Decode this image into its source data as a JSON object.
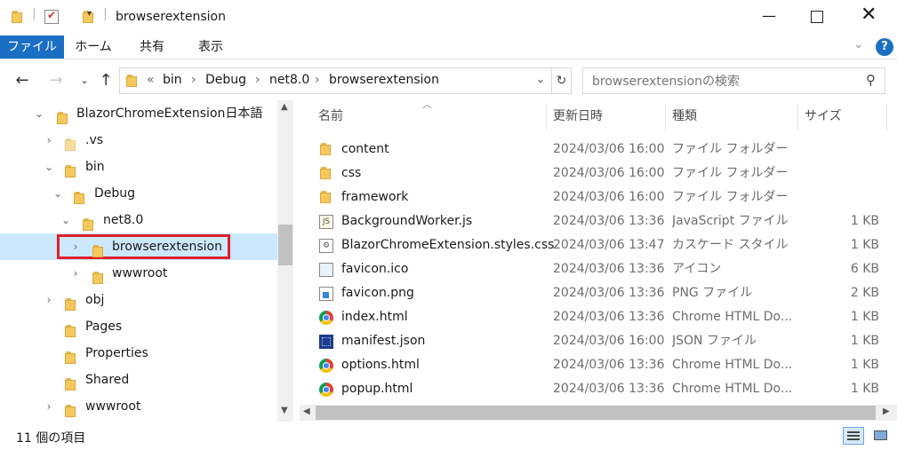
{
  "titlebar": {
    "title": "browserextension"
  },
  "ribbon": {
    "tabs": [
      "ファイル",
      "ホーム",
      "共有",
      "表示"
    ]
  },
  "address": {
    "crumbs": [
      "bin",
      "Debug",
      "net8.0",
      "browserextension"
    ],
    "prefix": "«"
  },
  "search": {
    "placeholder": "browserextensionの検索"
  },
  "tree": {
    "items": [
      {
        "label": "BlazorChromeExtension日本語"
      },
      {
        "label": ".vs"
      },
      {
        "label": "bin"
      },
      {
        "label": "Debug"
      },
      {
        "label": "net8.0"
      },
      {
        "label": "browserextension"
      },
      {
        "label": "wwwroot"
      },
      {
        "label": "obj"
      },
      {
        "label": "Pages"
      },
      {
        "label": "Properties"
      },
      {
        "label": "Shared"
      },
      {
        "label": "wwwroot"
      }
    ]
  },
  "columns": {
    "name": "名前",
    "date": "更新日時",
    "type": "種類",
    "size": "サイズ"
  },
  "files": [
    {
      "name": "content",
      "date": "2024/03/06 16:00",
      "type": "ファイル フォルダー",
      "size": "",
      "icon": "folder-icon"
    },
    {
      "name": "css",
      "date": "2024/03/06 16:00",
      "type": "ファイル フォルダー",
      "size": "",
      "icon": "folder-icon"
    },
    {
      "name": "framework",
      "date": "2024/03/06 16:00",
      "type": "ファイル フォルダー",
      "size": "",
      "icon": "folder-icon"
    },
    {
      "name": "BackgroundWorker.js",
      "date": "2024/03/06 13:36",
      "type": "JavaScript ファイル",
      "size": "1 KB",
      "icon": "js-file-icon"
    },
    {
      "name": "BlazorChromeExtension.styles.css",
      "date": "2024/03/06 13:47",
      "type": "カスケード スタイル シ...",
      "size": "1 KB",
      "icon": "css-file-icon"
    },
    {
      "name": "favicon.ico",
      "date": "2024/03/06 13:36",
      "type": "アイコン",
      "size": "6 KB",
      "icon": "ico-file-icon"
    },
    {
      "name": "favicon.png",
      "date": "2024/03/06 13:36",
      "type": "PNG ファイル",
      "size": "2 KB",
      "icon": "png-file-icon"
    },
    {
      "name": "index.html",
      "date": "2024/03/06 13:36",
      "type": "Chrome HTML Do...",
      "size": "1 KB",
      "icon": "chrome-icon"
    },
    {
      "name": "manifest.json",
      "date": "2024/03/06 16:00",
      "type": "JSON ファイル",
      "size": "1 KB",
      "icon": "json-file-icon"
    },
    {
      "name": "options.html",
      "date": "2024/03/06 13:36",
      "type": "Chrome HTML Do...",
      "size": "1 KB",
      "icon": "chrome-icon"
    },
    {
      "name": "popup.html",
      "date": "2024/03/06 13:36",
      "type": "Chrome HTML Do...",
      "size": "1 KB",
      "icon": "chrome-icon"
    }
  ],
  "status": {
    "count": "11 個の項目"
  },
  "colors": {
    "accent": "#1a6fc4",
    "selection": "#cce8ff",
    "highlight_border": "#e0202a"
  }
}
